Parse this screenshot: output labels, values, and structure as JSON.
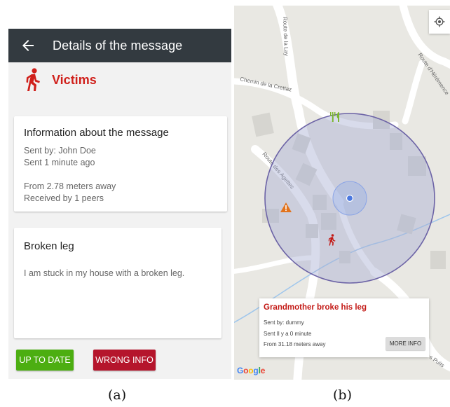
{
  "panel_a": {
    "appbar": {
      "title": "Details of the message",
      "back_icon": "arrow-back-icon"
    },
    "category": {
      "label": "Victims",
      "icon": "walking-person-icon",
      "color": "#d0201b"
    },
    "info_card": {
      "title": "Information about the message",
      "sent_by": "Sent by: John Doe",
      "sent_time": "Sent 1 minute ago",
      "distance": "From 2.78 meters away",
      "received": "Received by 1 peers"
    },
    "message_card": {
      "title": "Broken leg",
      "body": "I am stuck in my house with a broken leg."
    },
    "buttons": {
      "up_to_date": "UP TO DATE",
      "wrong_info": "WRONG INFO"
    },
    "colors": {
      "appbar": "#333a40",
      "green": "#4cae11",
      "red": "#b5152c"
    }
  },
  "panel_b": {
    "road_labels": {
      "route_lay": "Route de la Lay",
      "route_herens": "Route d'Hérémence",
      "chemin_crettaz": "Chemin de la Crettaz",
      "route_agettes": "Route des Agettes",
      "puits": "s Puits"
    },
    "popup": {
      "title": "Grandmother broke his leg",
      "sent_by": "Sent by: dummy",
      "sent_time": "Sent Il y a 0 minute",
      "distance": "From 31.18 meters away",
      "more_info": "MORE INFO"
    },
    "markers": [
      "restaurant-icon",
      "warning-icon",
      "walking-person-icon",
      "my-location-dot"
    ],
    "google": "Google"
  },
  "captions": {
    "a": "(a)",
    "b": "(b)"
  }
}
